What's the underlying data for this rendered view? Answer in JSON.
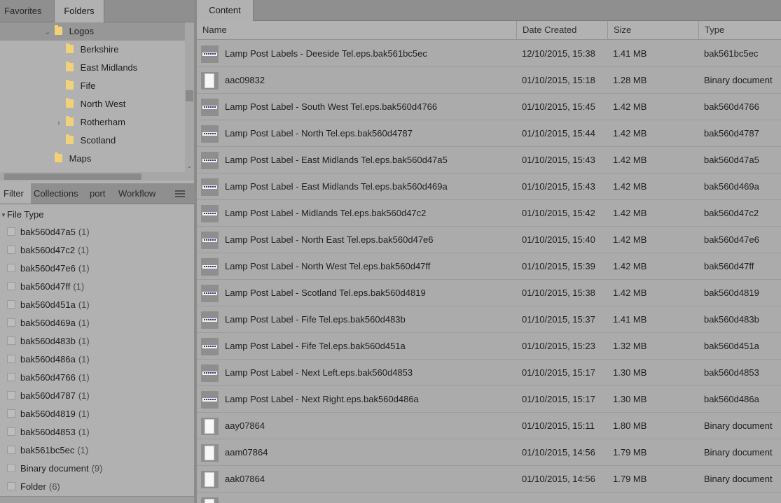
{
  "left_tabs": {
    "favorites": "Favorites",
    "folders": "Folders"
  },
  "folder_tree": [
    {
      "label": "Logos",
      "chevron": "⌄",
      "indent": 1,
      "selected": true
    },
    {
      "label": "Berkshire",
      "chevron": "",
      "indent": 2
    },
    {
      "label": "East Midlands",
      "chevron": "",
      "indent": 2
    },
    {
      "label": "Fife",
      "chevron": "",
      "indent": 2
    },
    {
      "label": "North West",
      "chevron": "",
      "indent": 2
    },
    {
      "label": "Rotherham",
      "chevron": "›",
      "indent": 2
    },
    {
      "label": "Scotland",
      "chevron": "",
      "indent": 2
    },
    {
      "label": "Maps",
      "chevron": "",
      "indent": 1
    }
  ],
  "filter_tabs": {
    "filter": "Filter",
    "collections": "Collections",
    "export": "port",
    "workflow": "Workflow"
  },
  "filter": {
    "header": "File Type",
    "items": [
      {
        "label": "bak560d47a5",
        "count": "(1)"
      },
      {
        "label": "bak560d47c2",
        "count": "(1)"
      },
      {
        "label": "bak560d47e6",
        "count": "(1)"
      },
      {
        "label": "bak560d47ff",
        "count": "(1)"
      },
      {
        "label": "bak560d451a",
        "count": "(1)"
      },
      {
        "label": "bak560d469a",
        "count": "(1)"
      },
      {
        "label": "bak560d483b",
        "count": "(1)"
      },
      {
        "label": "bak560d486a",
        "count": "(1)"
      },
      {
        "label": "bak560d4766",
        "count": "(1)"
      },
      {
        "label": "bak560d4787",
        "count": "(1)"
      },
      {
        "label": "bak560d4819",
        "count": "(1)"
      },
      {
        "label": "bak560d4853",
        "count": "(1)"
      },
      {
        "label": "bak561bc5ec",
        "count": "(1)"
      },
      {
        "label": "Binary document",
        "count": "(9)"
      },
      {
        "label": "Folder",
        "count": "(6)"
      }
    ]
  },
  "content_tab": "Content",
  "columns": {
    "name": "Name",
    "date": "Date Created",
    "size": "Size",
    "type": "Type"
  },
  "files": [
    {
      "name": "Lamp Post Labels - Deeside Tel.eps.bak561bc5ec",
      "date": "12/10/2015, 15:38",
      "size": "1.41 MB",
      "type": "bak561bc5ec",
      "thumb": "label"
    },
    {
      "name": "aac09832",
      "date": "01/10/2015, 15:18",
      "size": "1.28 MB",
      "type": "Binary document",
      "thumb": "doc"
    },
    {
      "name": "Lamp Post Label - South West Tel.eps.bak560d4766",
      "date": "01/10/2015, 15:45",
      "size": "1.42 MB",
      "type": "bak560d4766",
      "thumb": "label"
    },
    {
      "name": "Lamp Post Label - North Tel.eps.bak560d4787",
      "date": "01/10/2015, 15:44",
      "size": "1.42 MB",
      "type": "bak560d4787",
      "thumb": "label"
    },
    {
      "name": "Lamp Post Label - East Midlands Tel.eps.bak560d47a5",
      "date": "01/10/2015, 15:43",
      "size": "1.42 MB",
      "type": "bak560d47a5",
      "thumb": "label"
    },
    {
      "name": "Lamp Post Label - East Midlands Tel.eps.bak560d469a",
      "date": "01/10/2015, 15:43",
      "size": "1.42 MB",
      "type": "bak560d469a",
      "thumb": "label"
    },
    {
      "name": "Lamp Post Label - Midlands Tel.eps.bak560d47c2",
      "date": "01/10/2015, 15:42",
      "size": "1.42 MB",
      "type": "bak560d47c2",
      "thumb": "label"
    },
    {
      "name": "Lamp Post Label - North East Tel.eps.bak560d47e6",
      "date": "01/10/2015, 15:40",
      "size": "1.42 MB",
      "type": "bak560d47e6",
      "thumb": "label"
    },
    {
      "name": "Lamp Post Label - North West Tel.eps.bak560d47ff",
      "date": "01/10/2015, 15:39",
      "size": "1.42 MB",
      "type": "bak560d47ff",
      "thumb": "label"
    },
    {
      "name": "Lamp Post Label - Scotland Tel.eps.bak560d4819",
      "date": "01/10/2015, 15:38",
      "size": "1.42 MB",
      "type": "bak560d4819",
      "thumb": "label"
    },
    {
      "name": "Lamp Post Label - Fife Tel.eps.bak560d483b",
      "date": "01/10/2015, 15:37",
      "size": "1.41 MB",
      "type": "bak560d483b",
      "thumb": "label"
    },
    {
      "name": "Lamp Post Label - Fife Tel.eps.bak560d451a",
      "date": "01/10/2015, 15:23",
      "size": "1.32 MB",
      "type": "bak560d451a",
      "thumb": "label"
    },
    {
      "name": "Lamp Post Label - Next Left.eps.bak560d4853",
      "date": "01/10/2015, 15:17",
      "size": "1.30 MB",
      "type": "bak560d4853",
      "thumb": "label"
    },
    {
      "name": "Lamp Post Label - Next Right.eps.bak560d486a",
      "date": "01/10/2015, 15:17",
      "size": "1.30 MB",
      "type": "bak560d486a",
      "thumb": "label"
    },
    {
      "name": "aay07864",
      "date": "01/10/2015, 15:11",
      "size": "1.80 MB",
      "type": "Binary document",
      "thumb": "doc"
    },
    {
      "name": "aam07864",
      "date": "01/10/2015, 14:56",
      "size": "1.79 MB",
      "type": "Binary document",
      "thumb": "doc"
    },
    {
      "name": "aak07864",
      "date": "01/10/2015, 14:56",
      "size": "1.79 MB",
      "type": "Binary document",
      "thumb": "doc"
    }
  ]
}
